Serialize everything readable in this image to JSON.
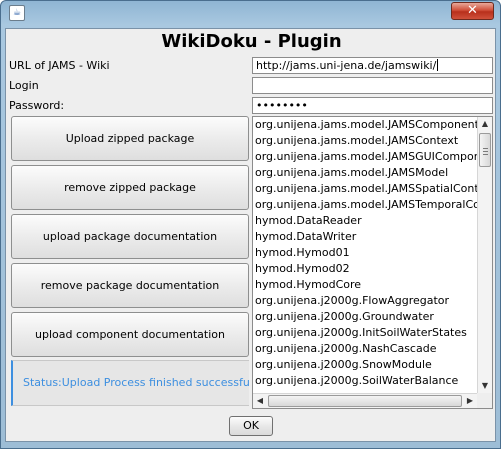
{
  "window": {
    "app_icon": "☕",
    "close_glyph": "✕"
  },
  "heading": "WikiDoku - Plugin",
  "fields": {
    "url_label": "URL of JAMS - Wiki",
    "url_value": "http://jams.uni-jena.de/jamswiki/",
    "login_label": "Login",
    "login_value": "",
    "password_label": "Password:",
    "password_value": "••••••••"
  },
  "buttons": {
    "upload_zipped": "Upload zipped package",
    "remove_zipped": "remove zipped package",
    "upload_pkg_doc": "upload package documentation",
    "remove_pkg_doc": "remove package documentation",
    "upload_comp_doc": "upload component documentation",
    "ok": "OK"
  },
  "status": "Status:Upload Process finished successfully",
  "components": [
    "org.unijena.jams.model.JAMSComponent",
    "org.unijena.jams.model.JAMSContext",
    "org.unijena.jams.model.JAMSGUIComponent",
    "org.unijena.jams.model.JAMSModel",
    "org.unijena.jams.model.JAMSSpatialContext",
    "org.unijena.jams.model.JAMSTemporalContext",
    "hymod.DataReader",
    "hymod.DataWriter",
    "hymod.Hymod01",
    "hymod.Hymod02",
    "hymod.HymodCore",
    "org.unijena.j2000g.FlowAggregator",
    "org.unijena.j2000g.Groundwater",
    "org.unijena.j2000g.InitSoilWaterStates",
    "org.unijena.j2000g.NashCascade",
    "org.unijena.j2000g.SnowModule",
    "org.unijena.j2000g.SoilWaterBalance"
  ],
  "icons": {
    "app": "java-cup-icon",
    "close": "close-icon",
    "scroll_up": "scroll-up-arrow-icon",
    "scroll_down": "scroll-down-arrow-icon",
    "scroll_left": "scroll-left-arrow-icon",
    "scroll_right": "scroll-right-arrow-icon"
  },
  "colors": {
    "status_text": "#3d8fe0",
    "close_button": "#c8402a"
  }
}
